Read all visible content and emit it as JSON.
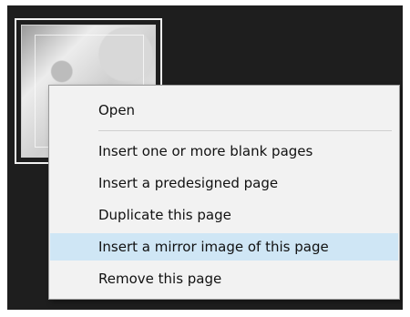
{
  "context_menu": {
    "items": [
      {
        "label": "Open"
      },
      {
        "label": "Insert one or more blank pages"
      },
      {
        "label": "Insert a predesigned page"
      },
      {
        "label": "Duplicate this page"
      },
      {
        "label": "Insert a mirror image of this page"
      },
      {
        "label": "Remove this page"
      }
    ],
    "highlighted_index": 4,
    "highlight_color": "#cfe6f5"
  },
  "icons": [
    "page-thumbnail"
  ]
}
